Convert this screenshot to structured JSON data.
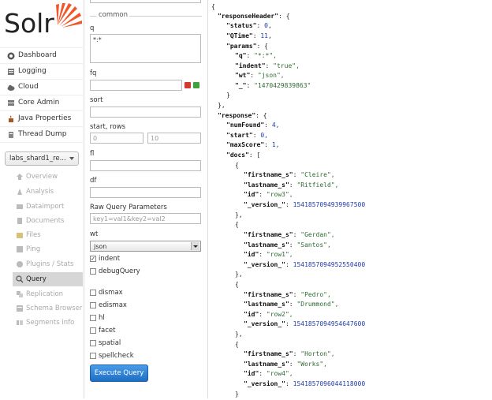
{
  "logo": {
    "text": "Solr"
  },
  "nav": {
    "items": [
      {
        "label": "Dashboard",
        "icon": "dashboard-icon"
      },
      {
        "label": "Logging",
        "icon": "logging-icon"
      },
      {
        "label": "Cloud",
        "icon": "cloud-icon"
      },
      {
        "label": "Core Admin",
        "icon": "core-admin-icon"
      },
      {
        "label": "Java Properties",
        "icon": "java-icon"
      },
      {
        "label": "Thread Dump",
        "icon": "thread-dump-icon"
      }
    ],
    "core_selector": "labs_shard1_re...",
    "core_items": [
      {
        "label": "Overview",
        "icon": "overview-icon",
        "active": false
      },
      {
        "label": "Analysis",
        "icon": "analysis-icon",
        "active": false
      },
      {
        "label": "Dataimport",
        "icon": "dataimport-icon",
        "active": false
      },
      {
        "label": "Documents",
        "icon": "documents-icon",
        "active": false
      },
      {
        "label": "Files",
        "icon": "files-icon",
        "active": false
      },
      {
        "label": "Ping",
        "icon": "ping-icon",
        "active": false
      },
      {
        "label": "Plugins / Stats",
        "icon": "plugins-icon",
        "active": false
      },
      {
        "label": "Query",
        "icon": "query-icon",
        "active": true
      },
      {
        "label": "Replication",
        "icon": "replication-icon",
        "active": false
      },
      {
        "label": "Schema Browser",
        "icon": "schema-icon",
        "active": false
      },
      {
        "label": "Segments info",
        "icon": "segments-icon",
        "active": false
      }
    ]
  },
  "form": {
    "section_common": "common",
    "q_label": "q",
    "q_value": "*:*",
    "fq_label": "fq",
    "sort_label": "sort",
    "start_rows_label": "start, rows",
    "start_value": "0",
    "rows_value": "10",
    "fl_label": "fl",
    "df_label": "df",
    "raw_label": "Raw Query Parameters",
    "raw_placeholder": "key1=val1&key2=val2",
    "wt_label": "wt",
    "wt_value": "json",
    "indent_label": "indent",
    "debug_label": "debugQuery",
    "options": [
      "dismax",
      "edismax",
      "hl",
      "facet",
      "spatial",
      "spellcheck"
    ],
    "execute_label": "Execute Query"
  },
  "response": {
    "status": "0",
    "qtime": "11",
    "params": {
      "q": "\"*:*\",",
      "indent": "\"true\",",
      "wt": "\"json\",",
      "_": "\"1470429839863\""
    },
    "numFound": "4,",
    "start": "0,",
    "maxScore": "1,",
    "docs": [
      {
        "firstname": "\"Cleire\",",
        "lastname": "\"Ritfield\",",
        "id": "\"row3\",",
        "version": "1541857094939967500"
      },
      {
        "firstname": "\"Gerdan\",",
        "lastname": "\"Santos\",",
        "id": "\"row1\",",
        "version": "1541857094952550400"
      },
      {
        "firstname": "\"Pedro\",",
        "lastname": "\"Drummond\",",
        "id": "\"row2\",",
        "version": "1541857094954647600"
      },
      {
        "firstname": "\"Horton\",",
        "lastname": "\"Works\",",
        "id": "\"row4\",",
        "version": "1541857096044118000"
      }
    ]
  },
  "colors": {
    "key": "#111111",
    "string": "#2f6a31",
    "number": "#1f3ba8",
    "accent": "#1d6fc4",
    "logo_orange": "#f0582a"
  }
}
